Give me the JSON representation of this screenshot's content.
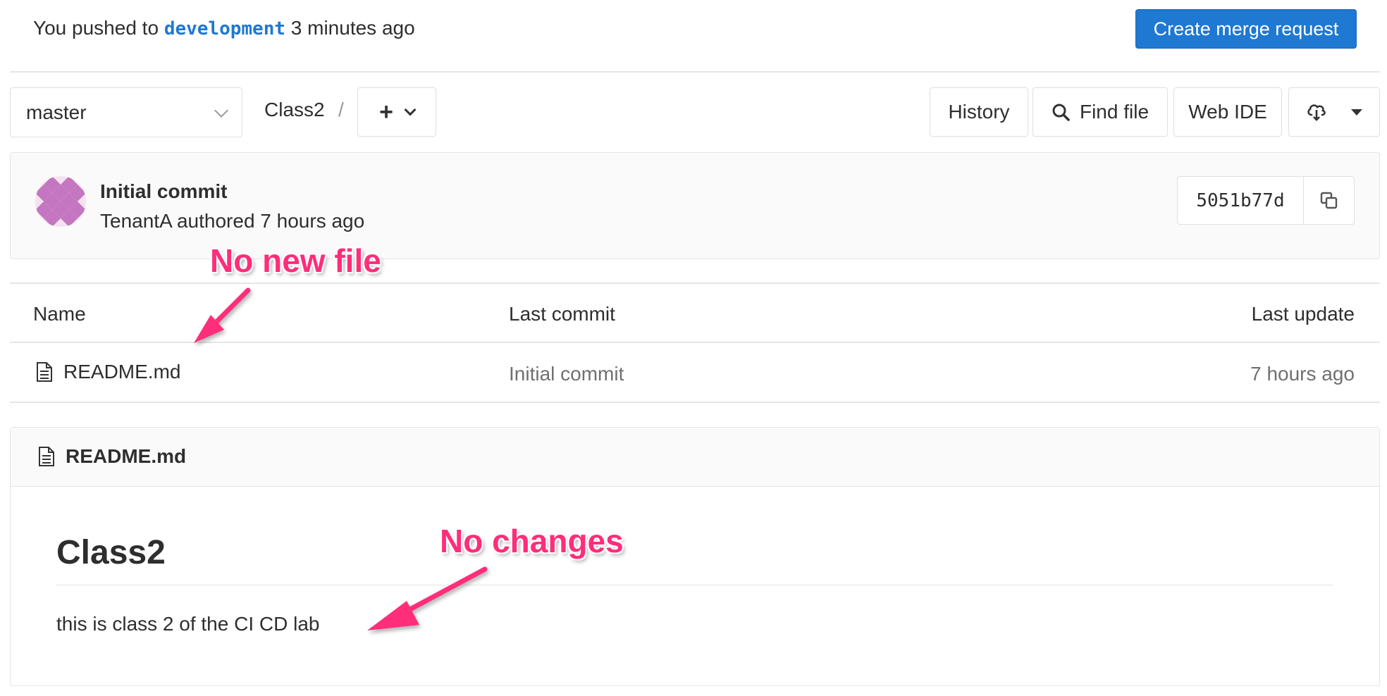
{
  "banner": {
    "prefix": "You pushed to",
    "branch": "development",
    "suffix": "3 minutes ago",
    "merge_request_label": "Create merge request"
  },
  "nav": {
    "branch": "master",
    "breadcrumb": "Class2",
    "separator": "/",
    "plus": "+",
    "history": "History",
    "find_file": "Find file",
    "web_ide": "Web IDE"
  },
  "commit": {
    "title": "Initial commit",
    "author_line": "TenantA authored 7 hours ago",
    "sha": "5051b77d"
  },
  "table": {
    "headers": [
      "Name",
      "Last commit",
      "Last update"
    ],
    "rows": [
      {
        "name": "README.md",
        "last_commit": "Initial commit",
        "last_update": "7 hours ago"
      }
    ]
  },
  "readme": {
    "filename": "README.md",
    "heading": "Class2",
    "body": "this is class 2 of the CI CD lab"
  },
  "annotations": {
    "no_new_file": "No new file",
    "no_changes": "No changes"
  },
  "colors": {
    "primary": "#1f78d1",
    "annotation": "#ff2d7a",
    "avatar": "#c576c0"
  }
}
